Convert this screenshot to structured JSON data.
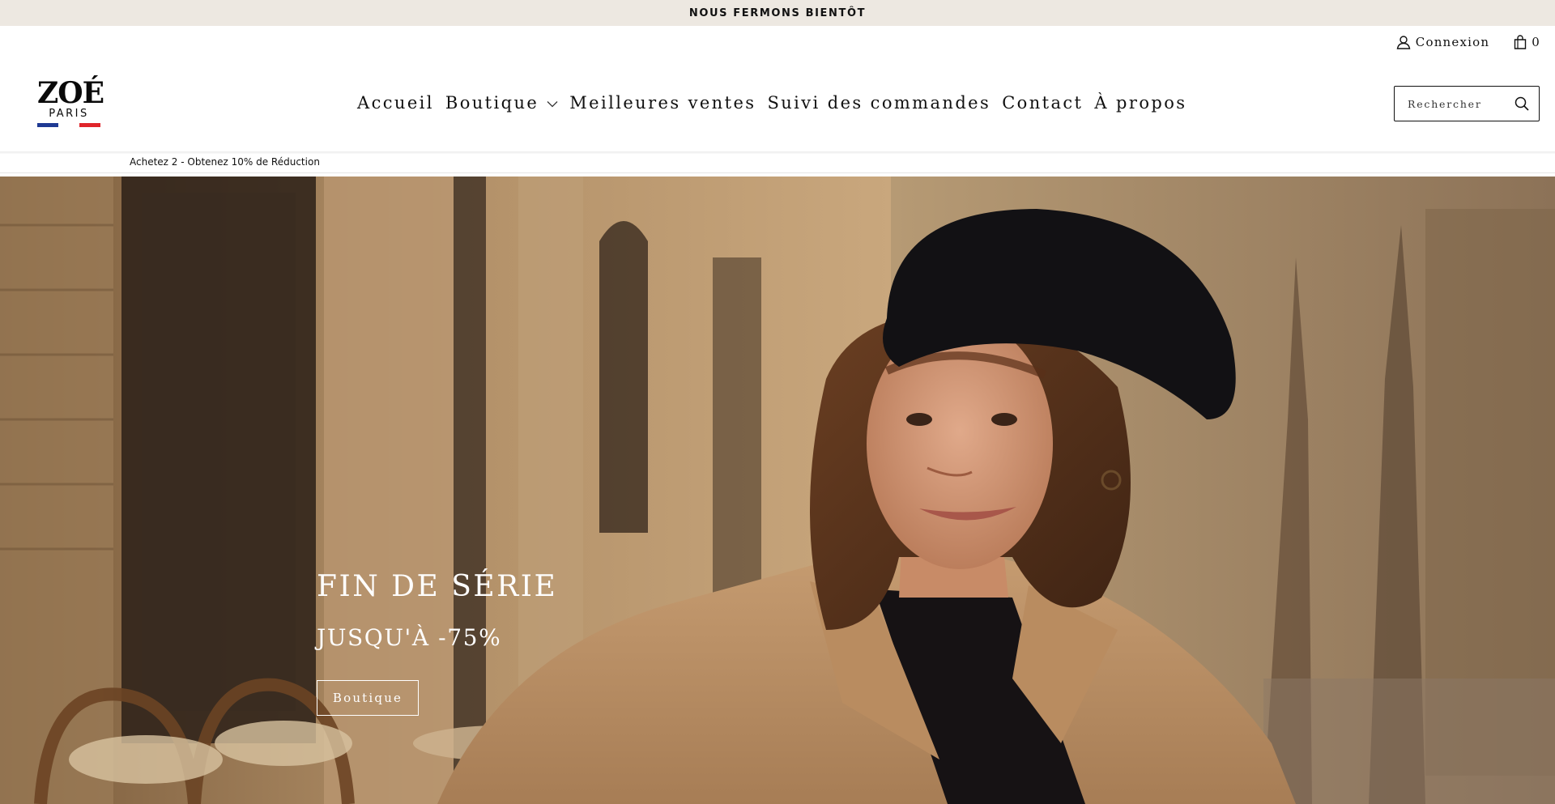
{
  "announcement": {
    "text": "NOUS FERMONS BIENTÔT"
  },
  "utility": {
    "login_label": "Connexion",
    "cart_count": "0"
  },
  "brand": {
    "name": "ZOÉ",
    "subtitle": "PARIS",
    "flag_colors": [
      "#1f3a93",
      "#ffffff",
      "#e0252b"
    ]
  },
  "nav": {
    "items": [
      {
        "label": "Accueil"
      },
      {
        "label": "Boutique",
        "has_dropdown": true
      },
      {
        "label": "Meilleures ventes"
      },
      {
        "label": "Suivi des commandes"
      },
      {
        "label": "Contact"
      },
      {
        "label": "À propos"
      }
    ]
  },
  "search": {
    "placeholder": "Rechercher",
    "icon": "search-icon"
  },
  "promo": {
    "text": "Achetez 2 - Obtenez 10% de Réduction"
  },
  "hero": {
    "title": "FIN DE SÉRIE",
    "subtitle": "JUSQU'À -75%",
    "button_label": "Boutique",
    "image_subject": "woman-in-beret-and-trench-coat-paris-street"
  },
  "icons": {
    "login": "user-icon",
    "cart": "shopping-bag-icon",
    "dropdown": "chevron-down-icon"
  }
}
